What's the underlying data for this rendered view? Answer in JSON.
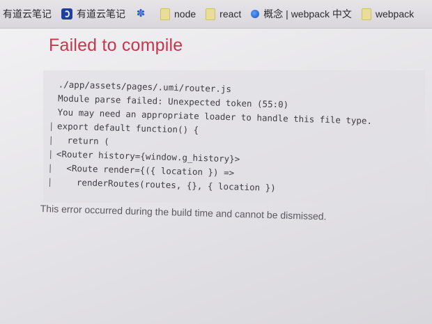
{
  "bookmarks": [
    {
      "label": "有道云笔记",
      "icon": "none"
    },
    {
      "label": "有道云笔记",
      "icon": "note-icon"
    },
    {
      "label": "",
      "icon": "paw-icon"
    },
    {
      "label": "node",
      "icon": "folder-icon"
    },
    {
      "label": "react",
      "icon": "folder-icon"
    },
    {
      "label": "概念 | webpack 中文",
      "icon": "globe-icon"
    },
    {
      "label": "webpack",
      "icon": "folder-icon"
    }
  ],
  "error": {
    "title": "Failed to compile",
    "code_lines": [
      {
        "gutter": "",
        "text": "./app/assets/pages/.umi/router.js"
      },
      {
        "gutter": "",
        "text": "Module parse failed: Unexpected token (55:0)"
      },
      {
        "gutter": "",
        "text": "You may need an appropriate loader to handle this file type."
      },
      {
        "gutter": "|",
        "text": "export default function() {"
      },
      {
        "gutter": "|",
        "text": "  return ("
      },
      {
        "gutter": "|",
        "text": "<Router history={window.g_history}>"
      },
      {
        "gutter": "|",
        "text": "  <Route render={({ location }) =>"
      },
      {
        "gutter": "|",
        "text": "    renderRoutes(routes, {}, { location })"
      }
    ],
    "note": "This error occurred during the build time and cannot be dismissed."
  }
}
